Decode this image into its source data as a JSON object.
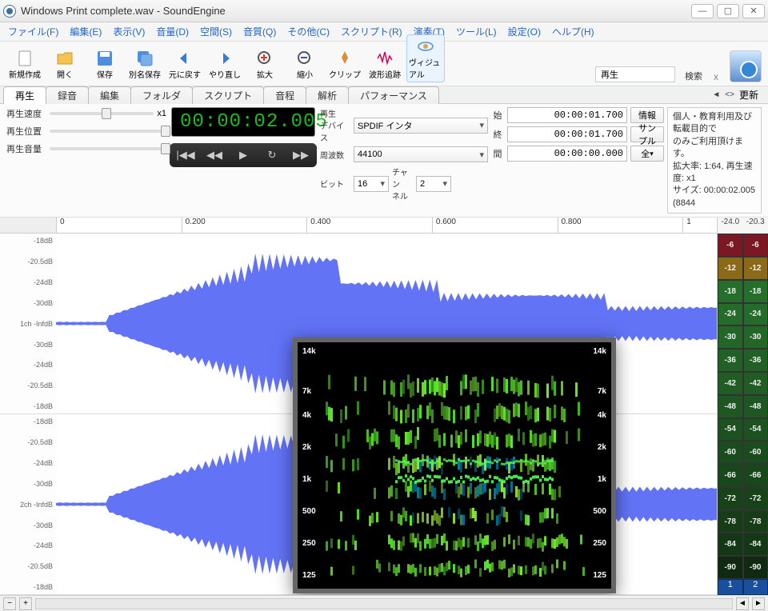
{
  "title": "Windows Print complete.wav - SoundEngine",
  "menu": [
    "ファイル(F)",
    "編集(E)",
    "表示(V)",
    "音量(D)",
    "空間(S)",
    "音質(Q)",
    "その他(C)",
    "スクリプト(R)",
    "演奏(T)",
    "ツール(L)",
    "設定(O)",
    "ヘルプ(H)"
  ],
  "toolbar_buttons": {
    "new": "新規作成",
    "open": "開く",
    "save": "保存",
    "saveas": "別名保存",
    "undo": "元に戻す",
    "redo": "やり直し",
    "zoomin": "拡大",
    "zoomout": "縮小",
    "clip": "クリップ",
    "trace": "波形追跡",
    "visual": "ヴィジュアル"
  },
  "playback_mode": "再生",
  "search": "検索",
  "tabs": [
    "再生",
    "録音",
    "編集",
    "フォルダ",
    "スクリプト",
    "音程",
    "解析",
    "パフォーマンス"
  ],
  "active_tab": "再生",
  "refresh": "更新",
  "sliders": {
    "speed": "再生速度",
    "pos": "再生位置",
    "vol": "再生音量",
    "x1": "x1"
  },
  "timecode": "00:00:02.005",
  "midlabels": {
    "device": "再生\nデバイス",
    "freq": "周波数",
    "bits": "ビット",
    "ch": "チャン\nネル"
  },
  "device": "SPDIF インタ",
  "freq": "44100",
  "bits": "16",
  "ch": "2",
  "range": {
    "start_l": "始",
    "end_l": "終",
    "dur_l": "間",
    "start": "00:00:01.700",
    "end": "00:00:01.700",
    "dur": "00:00:00.000"
  },
  "side_btn": {
    "info": "情報",
    "sample": "サンプル",
    "all": "全"
  },
  "info_lines": [
    "個人・教育利用及び転載目的で",
    "のみご利用頂けます。",
    "拡大率: 1:64, 再生速度: x1",
    "サイズ: 00:00:02.005 (8844"
  ],
  "timeline": [
    "0",
    "0.200",
    "0.400",
    "0.600",
    "0.800",
    "1"
  ],
  "db": [
    "-18dB",
    "-20.5dB",
    "-24dB",
    "-30dB",
    "1ch -InfdB",
    "-30dB",
    "-24dB",
    "-20.5dB",
    "-18dB"
  ],
  "db2": [
    "-18dB",
    "-20.5dB",
    "-24dB",
    "-30dB",
    "2ch -InfdB",
    "-30dB",
    "-24dB",
    "-20.5dB",
    "-18dB"
  ],
  "spectro_ticks": [
    "14k",
    "7k",
    "4k",
    "2k",
    "1k",
    "500",
    "250",
    "125"
  ],
  "meter_top": [
    "-24.0",
    "-20.3"
  ],
  "meter_vals": [
    "-6",
    "-12",
    "-18",
    "-24",
    "-30",
    "-36",
    "-42",
    "-48",
    "-54",
    "-60",
    "-66",
    "-72",
    "-78",
    "-84",
    "-90"
  ],
  "meter_colors": [
    "#7a1823",
    "#8a6a18",
    "#266e2b",
    "#256b2a",
    "#236628",
    "#216126",
    "#205c24",
    "#1e5722",
    "#1c5120",
    "#1b4c1e",
    "#19471c",
    "#17421a",
    "#163d18",
    "#143816",
    "#0f2a10"
  ],
  "meter_ch": [
    "1",
    "2"
  ]
}
